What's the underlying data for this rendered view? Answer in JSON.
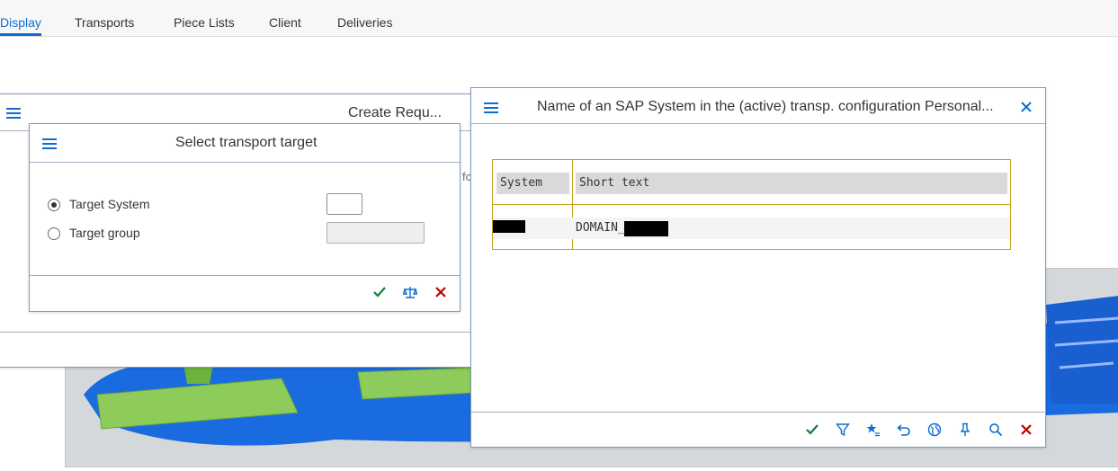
{
  "tabs": [
    {
      "label": "Display",
      "active": true
    },
    {
      "label": "Transports"
    },
    {
      "label": "Piece Lists"
    },
    {
      "label": "Client"
    },
    {
      "label": "Deliveries"
    }
  ],
  "create_dialog": {
    "title": "Create Requ...",
    "partial_text": "fo"
  },
  "target_dialog": {
    "title": "Select transport target",
    "options": [
      {
        "label": "Target System",
        "checked": true
      },
      {
        "label": "Target group",
        "checked": false
      }
    ],
    "footer_icons": [
      "checkmark-icon",
      "balance-icon",
      "close-icon"
    ]
  },
  "system_dialog": {
    "title": "Name of an SAP System in the (active) transp. configuration Personal...",
    "columns": [
      "System",
      "Short text"
    ],
    "rows": [
      {
        "system": "",
        "short_text": "DOMAIN_"
      }
    ],
    "footer_icons": [
      "checkmark-icon",
      "filter-icon",
      "star-icon",
      "undo-icon",
      "globe-icon",
      "pin-icon",
      "search-icon",
      "close-icon"
    ]
  },
  "colors": {
    "accent": "#0a6ed1",
    "ok": "#107e3e",
    "cancel": "#bb0000",
    "table_border": "#c9a020"
  }
}
